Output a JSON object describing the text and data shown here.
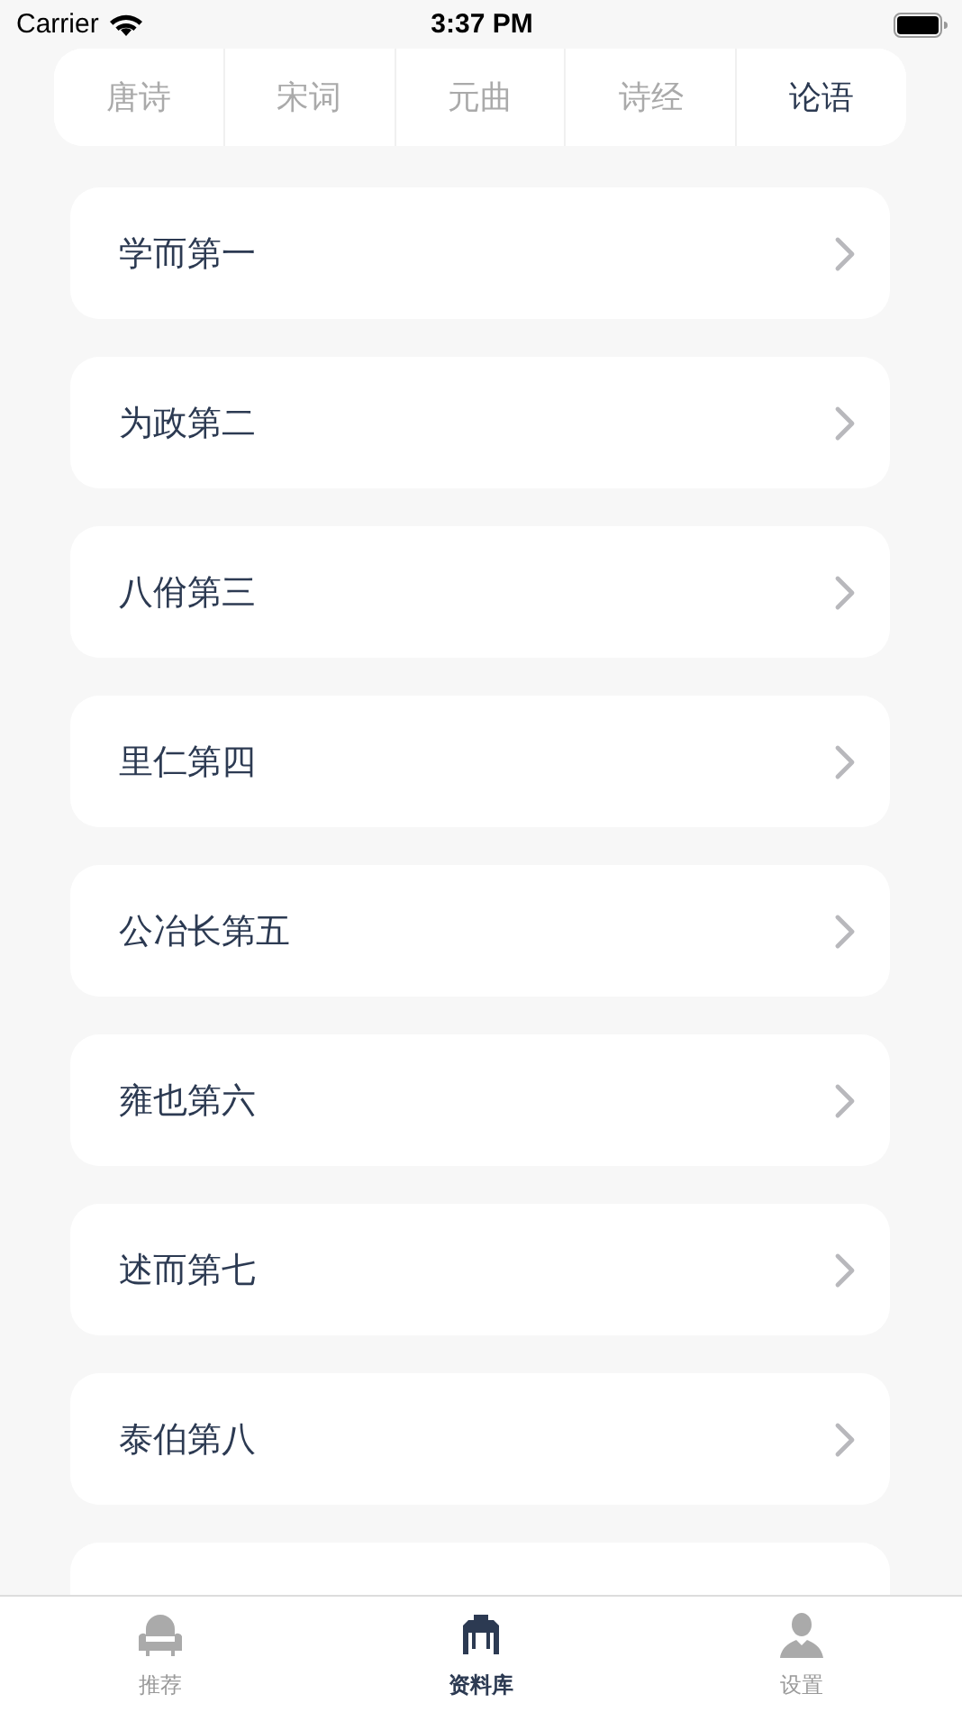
{
  "status_bar": {
    "carrier": "Carrier",
    "time": "3:37 PM"
  },
  "segments": [
    {
      "label": "唐诗",
      "selected": false
    },
    {
      "label": "宋词",
      "selected": false
    },
    {
      "label": "元曲",
      "selected": false
    },
    {
      "label": "诗经",
      "selected": false
    },
    {
      "label": "论语",
      "selected": true
    }
  ],
  "chapters": [
    {
      "title": "学而第一"
    },
    {
      "title": "为政第二"
    },
    {
      "title": "八佾第三"
    },
    {
      "title": "里仁第四"
    },
    {
      "title": "公冶长第五"
    },
    {
      "title": "雍也第六"
    },
    {
      "title": "述而第七"
    },
    {
      "title": "泰伯第八"
    }
  ],
  "tab_bar": [
    {
      "label": "推荐",
      "selected": false
    },
    {
      "label": "资料库",
      "selected": true
    },
    {
      "label": "设置",
      "selected": false
    }
  ]
}
